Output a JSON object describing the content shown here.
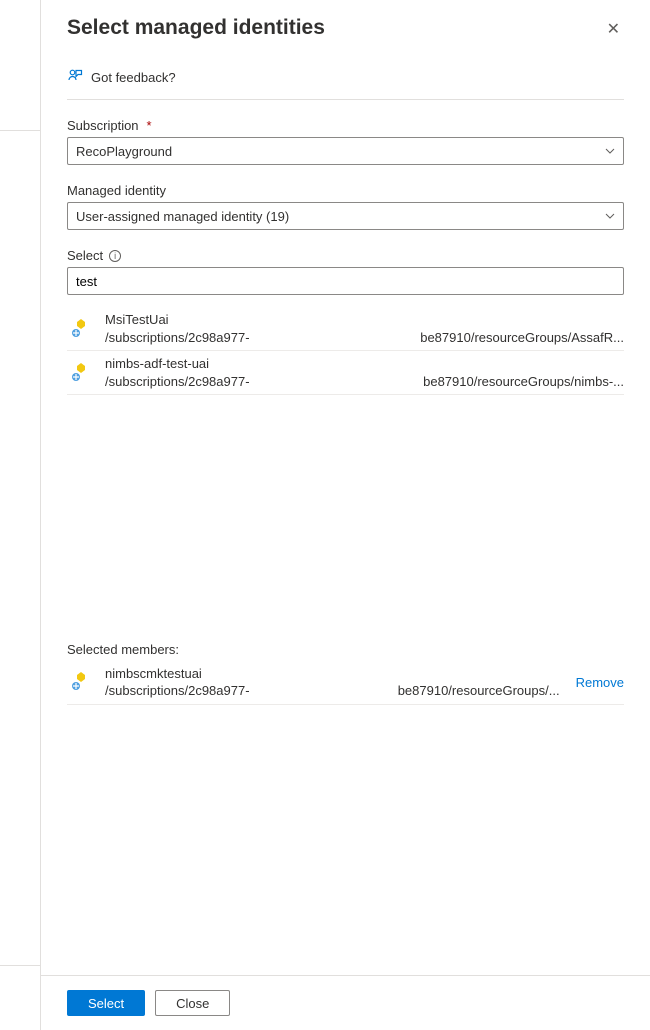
{
  "title": "Select managed identities",
  "feedback_text": "Got feedback?",
  "fields": {
    "subscription": {
      "label": "Subscription",
      "value": "RecoPlayground"
    },
    "managed_identity": {
      "label": "Managed identity",
      "value": "User-assigned managed identity (19)"
    },
    "select": {
      "label": "Select",
      "value": "test"
    }
  },
  "results": [
    {
      "name": "MsiTestUai",
      "path_left": "/subscriptions/2c98a977-",
      "path_right": "be87910/resourceGroups/AssafR..."
    },
    {
      "name": "nimbs-adf-test-uai",
      "path_left": "/subscriptions/2c98a977-",
      "path_right": "be87910/resourceGroups/nimbs-..."
    }
  ],
  "selected": {
    "heading": "Selected members:",
    "items": [
      {
        "name": "nimbscmktestuai",
        "path_left": "/subscriptions/2c98a977-",
        "path_right": "be87910/resourceGroups/...",
        "remove_label": "Remove"
      }
    ]
  },
  "buttons": {
    "select": "Select",
    "close": "Close"
  }
}
